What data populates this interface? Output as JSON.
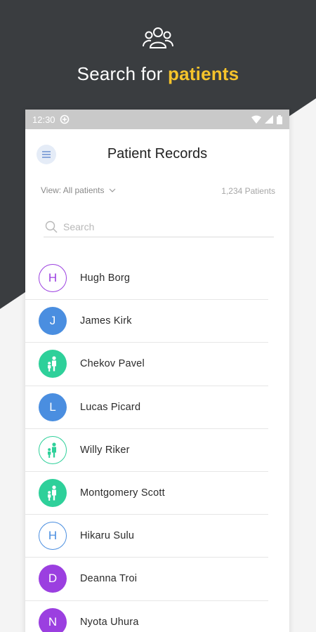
{
  "colors": {
    "dark_bg": "#3a3d40",
    "accent": "#f5c32b",
    "purple": "#9b3fe0",
    "blue": "#4a8ee0",
    "green": "#2ed09a"
  },
  "hero": {
    "icon": "people-group-icon",
    "title_prefix": "Search for",
    "title_accent": "patients"
  },
  "status_bar": {
    "time": "12:30",
    "icons": [
      "data-saver-icon",
      "wifi-icon",
      "signal-icon",
      "battery-icon"
    ]
  },
  "header": {
    "menu_icon": "menu-icon",
    "title": "Patient Records"
  },
  "filter": {
    "view_label": "View: All patients",
    "count_label": "1,234 Patients"
  },
  "search": {
    "placeholder": "Search",
    "value": ""
  },
  "patients": [
    {
      "name": "Hugh Borg",
      "initial": "H",
      "style": "outline",
      "color": "#9b3fe0",
      "icon": ""
    },
    {
      "name": "James Kirk",
      "initial": "J",
      "style": "filled",
      "color": "#4a8ee0",
      "icon": ""
    },
    {
      "name": "Chekov Pavel",
      "initial": "",
      "style": "filled",
      "color": "#2ed09a",
      "icon": "parent-child-icon"
    },
    {
      "name": "Lucas Picard",
      "initial": "L",
      "style": "filled",
      "color": "#4a8ee0",
      "icon": ""
    },
    {
      "name": "Willy Riker",
      "initial": "",
      "style": "outline",
      "color": "#2ed09a",
      "icon": "parent-child-icon"
    },
    {
      "name": "Montgomery Scott",
      "initial": "",
      "style": "filled",
      "color": "#2ed09a",
      "icon": "parent-child-icon"
    },
    {
      "name": "Hikaru Sulu",
      "initial": "H",
      "style": "outline",
      "color": "#4a8ee0",
      "icon": ""
    },
    {
      "name": "Deanna Troi",
      "initial": "D",
      "style": "filled",
      "color": "#9b3fe0",
      "icon": ""
    },
    {
      "name": "Nyota Uhura",
      "initial": "N",
      "style": "filled",
      "color": "#9b3fe0",
      "icon": ""
    }
  ]
}
